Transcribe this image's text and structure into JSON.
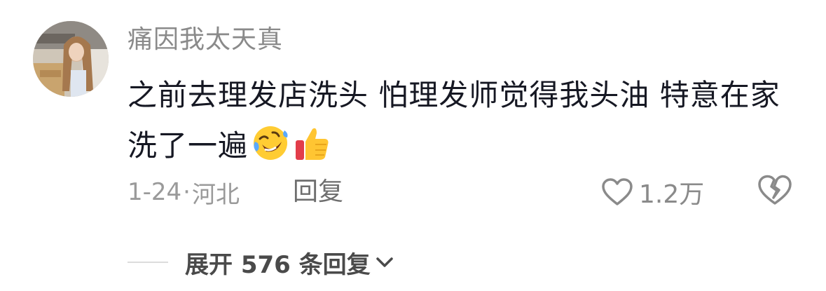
{
  "comment": {
    "username": "痛因我太天真",
    "text": "之前去理发店洗头 怕理发师觉得我头油 特意在家洗了一遍",
    "emojis": [
      "rolling-on-floor-laughing-emoji",
      "thumbs-up-emoji"
    ],
    "date": "1-24",
    "separator": "·",
    "location": "河北",
    "reply_label": "回复",
    "like_count": "1.2万",
    "expand_label": "展开 576 条回复"
  },
  "colors": {
    "text_primary": "#161823",
    "text_secondary": "#8a8a8a",
    "icon": "#8a8a8a",
    "divider": "#dcdcdc"
  }
}
